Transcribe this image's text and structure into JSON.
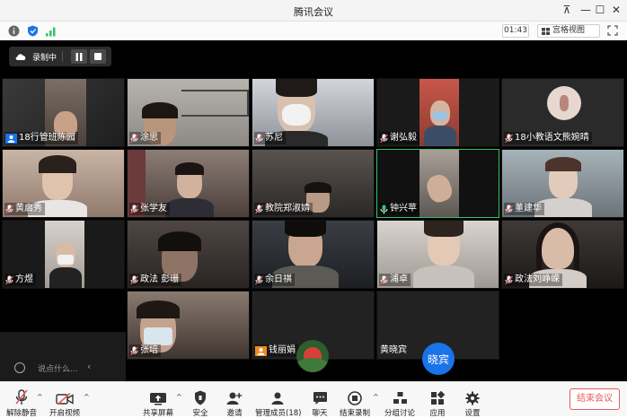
{
  "window": {
    "title": "腾讯会议",
    "controls": {
      "pin": "⊼",
      "minimize": "—",
      "maximize": "☐",
      "close": "✕"
    }
  },
  "infobar": {
    "timer": "01:43",
    "view_mode": "宫格视图"
  },
  "recording": {
    "status": "录制中"
  },
  "participants": [
    {
      "name": "18行管班陈园",
      "mic": "user",
      "active": false
    },
    {
      "name": "涂思",
      "mic": "muted",
      "active": false
    },
    {
      "name": "苏尼",
      "mic": "muted",
      "active": false
    },
    {
      "name": "谢弘毅",
      "mic": "muted",
      "active": false
    },
    {
      "name": "18小教语文熊婉晴",
      "mic": "muted",
      "active": false
    },
    {
      "name": "黄启秀",
      "mic": "muted",
      "active": false
    },
    {
      "name": "张学友",
      "mic": "muted",
      "active": false
    },
    {
      "name": "教院郑淑婧",
      "mic": "muted",
      "active": false
    },
    {
      "name": "钟兴苹",
      "mic": "on",
      "active": true
    },
    {
      "name": "董建华",
      "mic": "muted",
      "active": false
    },
    {
      "name": "方煜",
      "mic": "muted",
      "active": false
    },
    {
      "name": "政法 彭珊",
      "mic": "muted",
      "active": false
    },
    {
      "name": "余日祺",
      "mic": "muted",
      "active": false
    },
    {
      "name": "浦卓",
      "mic": "muted",
      "active": false
    },
    {
      "name": "政法刘峥嵘",
      "mic": "muted",
      "active": false
    },
    {
      "name": "张培",
      "mic": "muted",
      "active": false
    },
    {
      "name": "钱丽娟",
      "mic": "user",
      "active": false
    },
    {
      "name": "黄晓宾",
      "mic": "none",
      "active": false,
      "avatar_text": "晓宾"
    }
  ],
  "chat": {
    "placeholder": "说点什么...",
    "collapse": "‹"
  },
  "toolbar": {
    "unmute": "解除静音",
    "video": "开启视频",
    "share": "共享屏幕",
    "security": "安全",
    "invite": "邀请",
    "members": "管理成员(18)",
    "chat": "聊天",
    "end_record": "结束录制",
    "breakout": "分组讨论",
    "apps": "应用",
    "settings": "设置",
    "end_meeting": "结束会议"
  },
  "colors": {
    "accent_blue": "#1a73e8",
    "end_red": "#e35c5c",
    "active_green": "#36c36a"
  }
}
